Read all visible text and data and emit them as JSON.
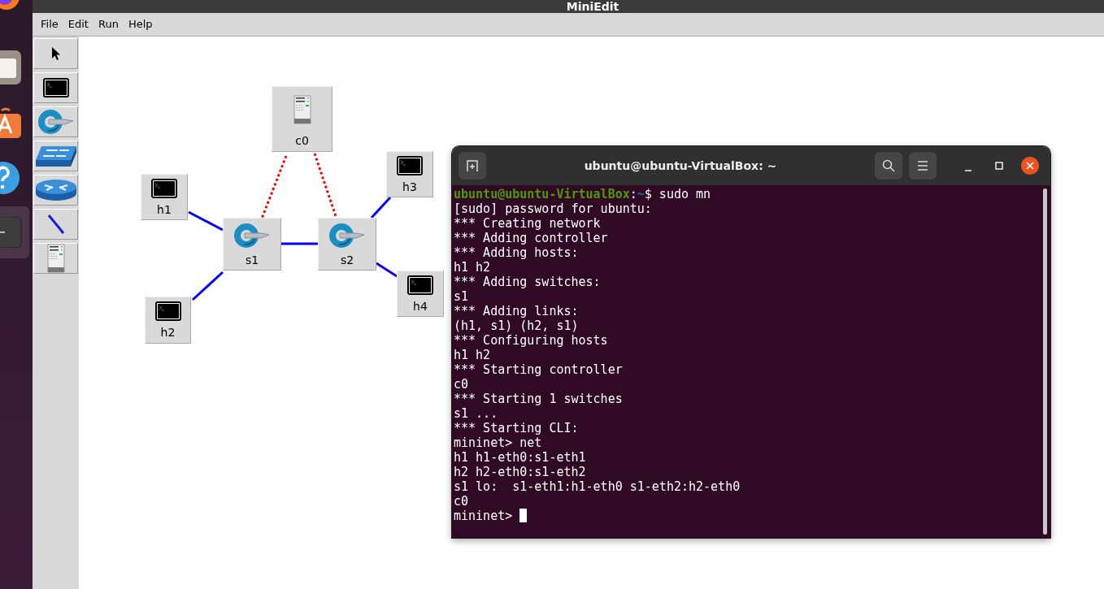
{
  "dock": [
    {
      "kind": "browser",
      "selected": false
    },
    {
      "kind": "files",
      "selected": false
    },
    {
      "kind": "store",
      "selected": false
    },
    {
      "kind": "help",
      "selected": false
    },
    {
      "kind": "terminal",
      "selected": true
    }
  ],
  "window": {
    "title": "MiniEdit"
  },
  "menu": [
    "File",
    "Edit",
    "Run",
    "Help"
  ],
  "tools": [
    {
      "kind": "select"
    },
    {
      "kind": "host"
    },
    {
      "kind": "switch"
    },
    {
      "kind": "legacy-switch"
    },
    {
      "kind": "router"
    },
    {
      "kind": "link"
    },
    {
      "kind": "controller"
    }
  ],
  "nodes": [
    {
      "label": "c0",
      "kind": "controller"
    },
    {
      "label": "h1",
      "kind": "host"
    },
    {
      "label": "s1",
      "kind": "switch"
    },
    {
      "label": "s2",
      "kind": "switch"
    },
    {
      "label": "h2",
      "kind": "host"
    },
    {
      "label": "h3",
      "kind": "host"
    },
    {
      "label": "h4",
      "kind": "host"
    }
  ],
  "links": [
    {
      "kind": "control"
    },
    {
      "kind": "control"
    },
    {
      "kind": "data"
    },
    {
      "kind": "data"
    },
    {
      "kind": "data"
    },
    {
      "kind": "data"
    },
    {
      "kind": "data"
    }
  ],
  "terminal": {
    "title": "ubuntu@ubuntu-VirtualBox: ~",
    "lines": [
      {
        "kind": "prompt",
        "user": "ubuntu@ubuntu-VirtualBox",
        "sep": ":",
        "path": "~",
        "text": "$ sudo mn"
      },
      {
        "kind": "out",
        "text": "[sudo] password for ubuntu:"
      },
      {
        "kind": "out",
        "text": "*** Creating network"
      },
      {
        "kind": "out",
        "text": "*** Adding controller"
      },
      {
        "kind": "out",
        "text": "*** Adding hosts:"
      },
      {
        "kind": "out",
        "text": "h1 h2"
      },
      {
        "kind": "out",
        "text": "*** Adding switches:"
      },
      {
        "kind": "out",
        "text": "s1"
      },
      {
        "kind": "out",
        "text": "*** Adding links:"
      },
      {
        "kind": "out",
        "text": "(h1, s1) (h2, s1)"
      },
      {
        "kind": "out",
        "text": "*** Configuring hosts"
      },
      {
        "kind": "out",
        "text": "h1 h2"
      },
      {
        "kind": "out",
        "text": "*** Starting controller"
      },
      {
        "kind": "out",
        "text": "c0"
      },
      {
        "kind": "out",
        "text": "*** Starting 1 switches"
      },
      {
        "kind": "out",
        "text": "s1 ..."
      },
      {
        "kind": "out",
        "text": "*** Starting CLI:"
      },
      {
        "kind": "out",
        "text": "mininet> net"
      },
      {
        "kind": "out",
        "text": "h1 h1-eth0:s1-eth1"
      },
      {
        "kind": "out",
        "text": "h2 h2-eth0:s1-eth2"
      },
      {
        "kind": "out",
        "text": "s1 lo:  s1-eth1:h1-eth0 s1-eth2:h2-eth0"
      },
      {
        "kind": "out",
        "text": "c0"
      },
      {
        "kind": "input",
        "text": "mininet> "
      }
    ]
  }
}
